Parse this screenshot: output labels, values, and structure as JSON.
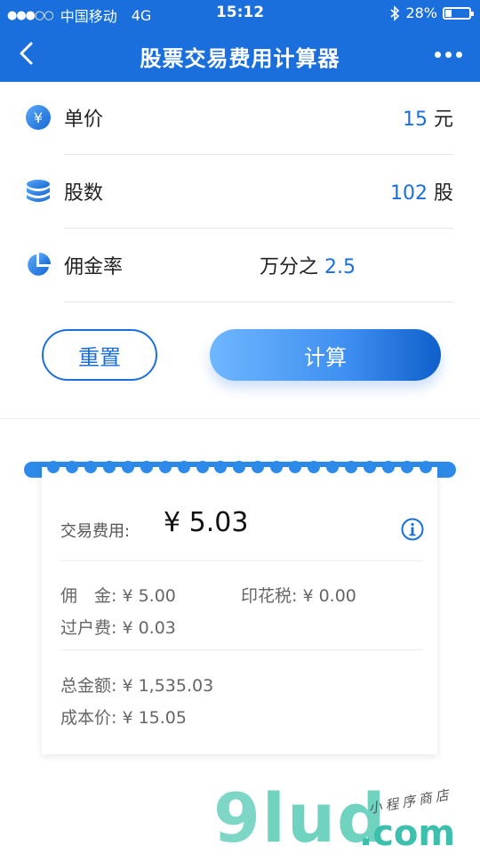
{
  "status_bar": {
    "signal": "●●●○○",
    "carrier": "中国移动",
    "network": "4G",
    "time": "15:12",
    "bluetooth": "bluetooth-icon",
    "battery_percent": "28%",
    "battery_level": 0.28
  },
  "nav": {
    "title": "股票交易费用计算器",
    "back_icon": "chevron-left-icon",
    "more_icon": "more-dots-icon"
  },
  "form": {
    "price": {
      "icon": "yuan-coin-icon",
      "label": "单价",
      "value": "15",
      "unit": "元"
    },
    "shares": {
      "icon": "database-stack-icon",
      "label": "股数",
      "value": "102",
      "unit": "股"
    },
    "commission_rate": {
      "icon": "pie-chart-icon",
      "label": "佣金率",
      "prefix": "万分之",
      "value": "2.5"
    }
  },
  "buttons": {
    "reset": "重置",
    "calculate": "计算"
  },
  "receipt": {
    "fee_label": "交易费用:",
    "fee_value": "¥ 5.03",
    "info_icon": "info-circle-icon",
    "commission": "佣　金: ¥ 5.00",
    "stamp_tax": "印花税: ¥ 0.00",
    "transfer_fee": "过户费: ¥ 0.03",
    "total_amount": "总金额: ¥ 1,535.03",
    "cost_price": "成本价: ¥ 15.05"
  },
  "watermark": {
    "g": "9",
    "lud": "lud",
    "com": ".com",
    "small": "小程序商店"
  },
  "colors": {
    "primary": "#1a6fdc",
    "receipt_accent": "#2d8ae8",
    "watermark": "#6fd3c0"
  }
}
